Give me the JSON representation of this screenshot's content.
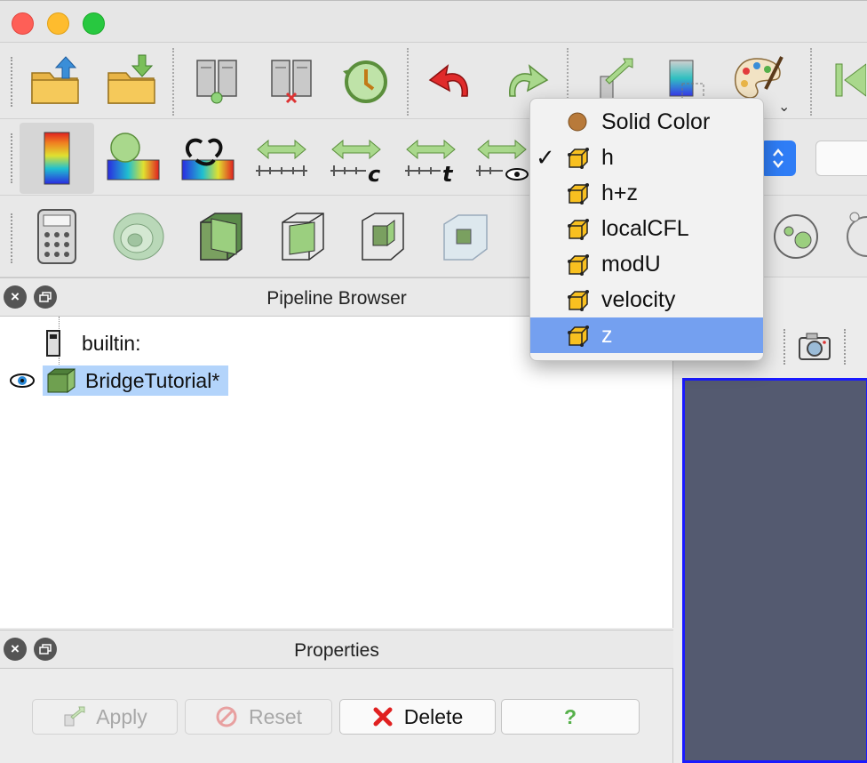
{
  "pipeline_browser": {
    "title": "Pipeline Browser",
    "items": [
      {
        "label": "builtin:"
      },
      {
        "label": "BridgeTutorial*"
      }
    ]
  },
  "properties": {
    "title": "Properties",
    "apply_label": "Apply",
    "reset_label": "Reset",
    "delete_label": "Delete",
    "help_label": "?"
  },
  "coloring_menu": {
    "items": [
      {
        "label": "Solid Color",
        "icon": "solid-color-icon",
        "checked": false,
        "highlighted": false
      },
      {
        "label": "h",
        "icon": "cell-array-icon",
        "checked": true,
        "highlighted": false
      },
      {
        "label": "h+z",
        "icon": "cell-array-icon",
        "checked": false,
        "highlighted": false
      },
      {
        "label": "localCFL",
        "icon": "cell-array-icon",
        "checked": false,
        "highlighted": false
      },
      {
        "label": "modU",
        "icon": "cell-array-icon",
        "checked": false,
        "highlighted": false
      },
      {
        "label": "velocity",
        "icon": "cell-array-icon",
        "checked": false,
        "highlighted": false
      },
      {
        "label": "z",
        "icon": "cell-array-icon",
        "checked": false,
        "highlighted": true
      }
    ],
    "check_mark": "✓"
  },
  "colors": {
    "highlight": "#74a0f0",
    "selection": "#b3d4fb",
    "render_bg": "#545a70",
    "render_border": "#1a1aff"
  }
}
